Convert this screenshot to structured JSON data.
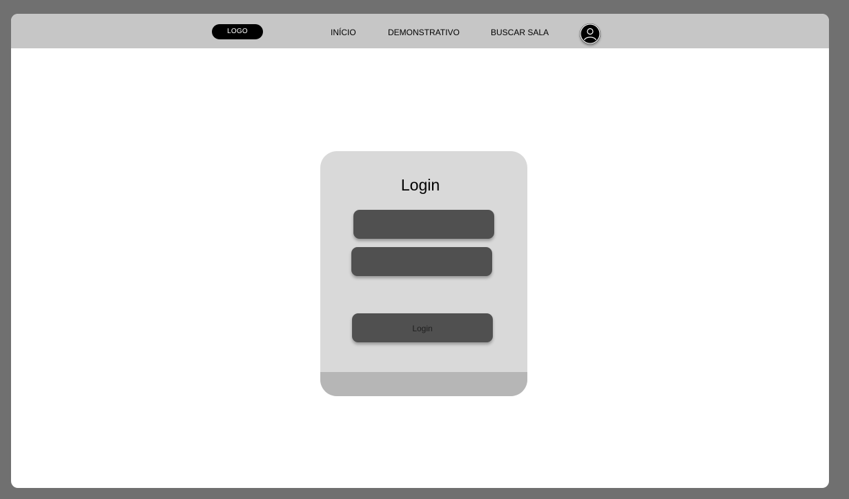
{
  "header": {
    "logo_label": "LOGO",
    "nav": [
      {
        "label": "INÍCIO"
      },
      {
        "label": "DEMONSTRATIVO"
      },
      {
        "label": "BUSCAR SALA"
      }
    ],
    "avatar_icon": "user-avatar-icon"
  },
  "login_card": {
    "title": "Login",
    "username": {
      "value": "",
      "placeholder": ""
    },
    "password": {
      "value": "",
      "placeholder": ""
    },
    "submit_label": "Login"
  },
  "colors": {
    "page_background": "#707070",
    "topbar": "#c6c6c6",
    "card": "#d9d9d9",
    "card_footer": "#b6b6b6",
    "field": "#505050",
    "logo": "#000000"
  }
}
